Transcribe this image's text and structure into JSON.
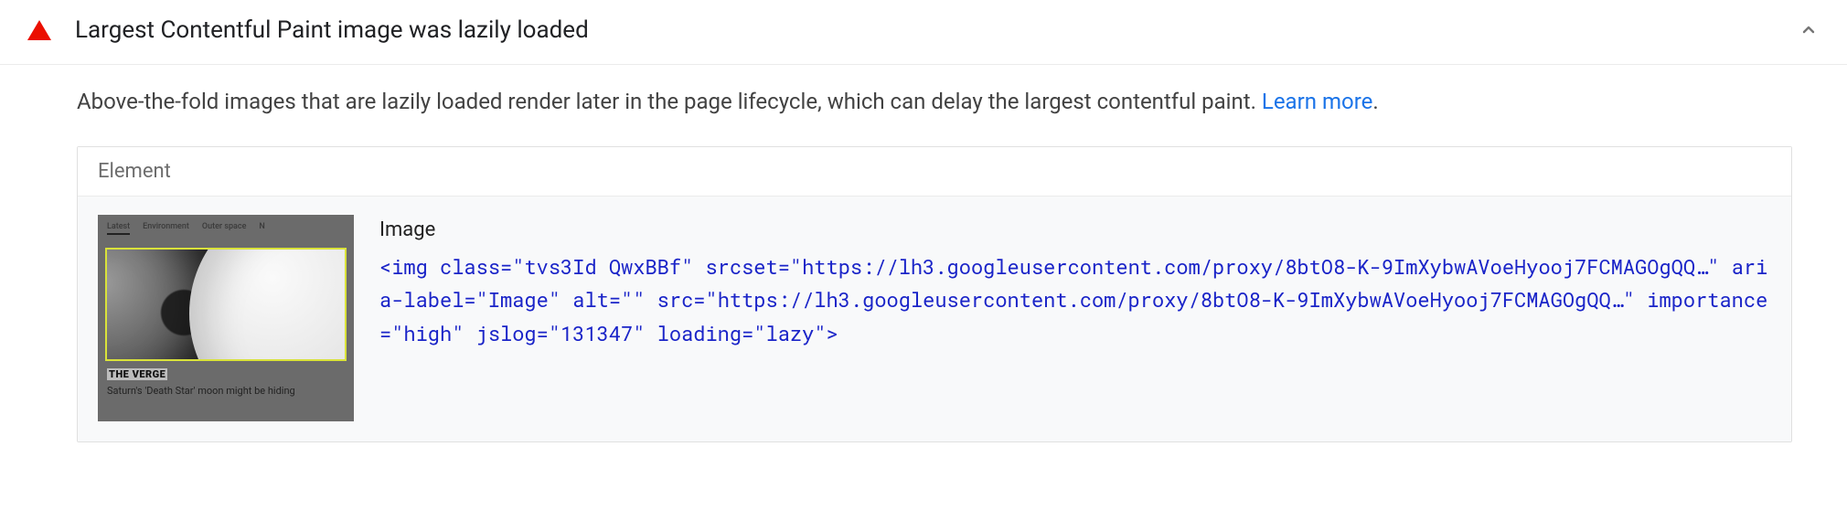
{
  "audit": {
    "title": "Largest Contentful Paint image was lazily loaded",
    "description": "Above-the-fold images that are lazily loaded render later in the page lifecycle, which can delay the largest contentful paint. ",
    "learn_more": "Learn more",
    "period": "."
  },
  "table": {
    "header": "Element",
    "row": {
      "node_label": "Image",
      "thumbnail": {
        "tabs": [
          "Latest",
          "Environment",
          "Outer space",
          "N"
        ],
        "source_logo": "THE VERGE",
        "caption": "Saturn's 'Death Star' moon might be hiding"
      },
      "snippet": {
        "tag": "img",
        "attrs": [
          {
            "name": "class",
            "value": "tvs3Id QwxBBf"
          },
          {
            "name": "srcset",
            "value": "https://lh3.googleusercontent.com/proxy/8btO8-K-9ImXybwAVoeHyooj7FCMAGOgQQ…"
          },
          {
            "name": "aria-label",
            "value": "Image"
          },
          {
            "name": "alt",
            "value": ""
          },
          {
            "name": "src",
            "value": "https://lh3.googleusercontent.com/proxy/8btO8-K-9ImXybwAVoeHyooj7FCMAGOgQQ…"
          },
          {
            "name": "importance",
            "value": "high"
          },
          {
            "name": "jslog",
            "value": "131347"
          },
          {
            "name": "loading",
            "value": "lazy"
          }
        ]
      }
    }
  }
}
